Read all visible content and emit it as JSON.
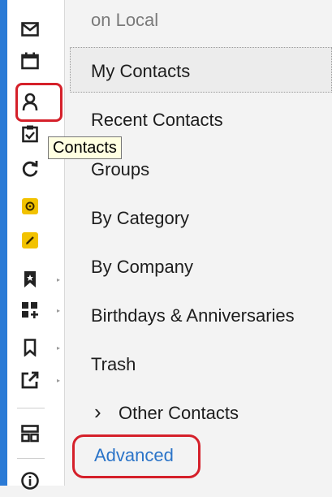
{
  "tooltip": {
    "text": "Contacts"
  },
  "nav": {
    "account_label": "on Local",
    "items": [
      {
        "label": "My Contacts",
        "selected": true
      },
      {
        "label": "Recent Contacts"
      },
      {
        "label": "Groups"
      },
      {
        "label": "By Category"
      },
      {
        "label": "By Company"
      },
      {
        "label": "Birthdays & Anniversaries"
      },
      {
        "label": "Trash"
      }
    ],
    "other_contacts": {
      "chevron": "›",
      "label": "Other Contacts"
    },
    "advanced_link": "Advanced"
  },
  "icons": [
    "mail-icon",
    "calendar-icon",
    "contacts-icon",
    "tasks-icon",
    "sync-icon",
    "settings-gear-icon",
    "pencil-edit-icon",
    "bookmark-icon",
    "add-apps-icon",
    "bookmark-outline-icon",
    "external-link-icon",
    "layout-grid-icon",
    "info-icon"
  ],
  "colors": {
    "accent_blue": "#2b7bd6",
    "highlight_red": "#d5202a",
    "tooltip_bg": "#ffffe1",
    "yellow_icon": "#f2c200",
    "link_blue": "#2b74c8"
  }
}
